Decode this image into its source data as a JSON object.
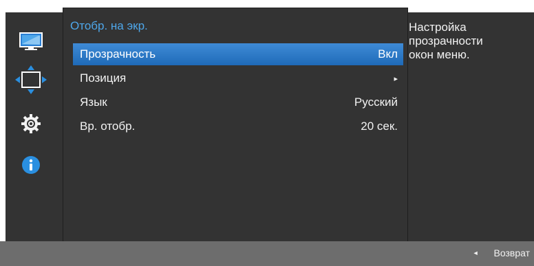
{
  "menu": {
    "title": "Отобр. на экр.",
    "items": [
      {
        "label": "Прозрачность",
        "value": "Вкл",
        "selected": true
      },
      {
        "label": "Позиция",
        "value": "▸",
        "selected": false
      },
      {
        "label": "Язык",
        "value": "Русский",
        "selected": false
      },
      {
        "label": "Вр. отобр.",
        "value": "20 сек.",
        "selected": false
      }
    ]
  },
  "sidebar": {
    "icons": [
      "monitor-icon",
      "move-arrows-icon",
      "gear-icon",
      "info-icon"
    ],
    "active": "move-arrows-icon"
  },
  "help": {
    "text_lines": [
      "Настройка",
      "прозрачности",
      "окон меню."
    ]
  },
  "bottom": {
    "back_label": "Возврат"
  },
  "colors": {
    "panel": "#333333",
    "accent": "#4ea7ea",
    "selected": "#2b78c6",
    "bottom_bar": "#6d6d6d"
  }
}
